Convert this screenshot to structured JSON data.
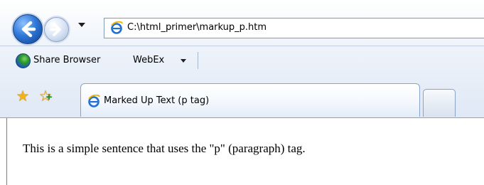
{
  "browser": {
    "address": "C:\\html_primer\\markup_p.htm",
    "links_bar": {
      "items": [
        {
          "label": "Share Browser",
          "icon": "globe-icon"
        },
        {
          "label": "WebEx",
          "icon": "chevron-down-icon"
        }
      ]
    },
    "tabs": [
      {
        "title": "Marked Up Text (p tag)",
        "active": true
      }
    ]
  },
  "page": {
    "paragraph": "This is a simple sentence that uses the \"p\" (paragraph) tag."
  },
  "colors": {
    "accent": "#2f79d8",
    "tab_border": "#8aa3c8",
    "favorites_star": "#f1b11a"
  }
}
